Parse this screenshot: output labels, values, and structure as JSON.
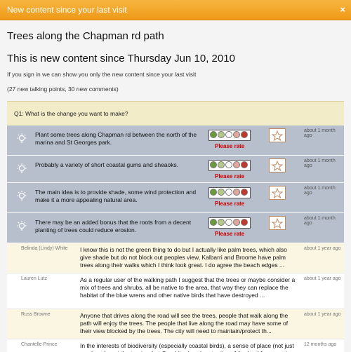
{
  "titlebar": {
    "title": "New content since your last visit",
    "close": "×"
  },
  "page": {
    "title": "Trees along the Chapman rd path",
    "subtitle": "This is new content since Thursday Jun 10, 2010",
    "signin_note": "If you sign in we can show you only the new content since your last visit",
    "counts": "(27 new talking points, 30 new comments)"
  },
  "question": "Q1: What is the change you want to make?",
  "proposals": [
    {
      "text": "Plant some trees along Chapman rd between the north of the marina and St Georges park.",
      "rate": "Please rate",
      "ago": "about 1 month ago"
    },
    {
      "text": "Probably a variety of short coastal gums and sheaoks.",
      "rate": "Please rate",
      "ago": "about 1 month ago"
    },
    {
      "text": "The main idea is to provide shade, some wind protection and make it a more appealing natural area.",
      "rate": "Please rate",
      "ago": "about 1 month ago"
    },
    {
      "text": "There may be an added bonus that the roots from a decent planting of trees could reduce erosion.",
      "rate": "Please rate",
      "ago": "about 1 month ago"
    }
  ],
  "comments": [
    {
      "name": "Belinda (Lindy) White",
      "text": "I know this is not the green thing to do but I actually like palm trees, which also give shade but do not block out peoples view, Kalbarri and Broome have palm trees along their walks which I think look great. I do agree the beach edges ...",
      "ago": "about 1 year ago",
      "bg": "#fbf6e2"
    },
    {
      "name": "Lauren Lutz",
      "text": "As a regular user of the walking path I suggest that the trees or maybe consider a mix of trees and shrubs, all be native to the area, that way they can replace the habitat of the blue wrens and other native birds that have destroyed ...",
      "ago": "about 1 year ago",
      "bg": "#ffffff"
    },
    {
      "name": "Russ Browne",
      "text": "Anyone that drives along the road will see the trees, people that walk along the path will enjoy the trees. The people that live along the road may have some of their view blocked by the trees. The city will need to maintain/protect th...",
      "ago": "about 1 year ago",
      "bg": "#fbf6e2"
    },
    {
      "name": "Chantelle Prince",
      "text": "In the interests of biodiversity (especially coastal birds), a sense of place (not just any beach, not the tropics, but Geraldton) and protection of the land from erosion (sea levels are already rising, land is already being lost) we sho...",
      "ago": "12 months ago",
      "bg": "#ffffff"
    }
  ],
  "colors": {
    "titlebar": "#f5a623",
    "question_bg": "#f3ecc9",
    "proposal_bg": "#b6bfcb",
    "rate_text": "#cc0000",
    "dot_colors": [
      "#6a9a3a",
      "#b5c98a",
      "#ffffff",
      "#e0a89a",
      "#c0392b"
    ]
  },
  "icons": {
    "bulb": "lightbulb-icon",
    "star": "star-icon"
  }
}
